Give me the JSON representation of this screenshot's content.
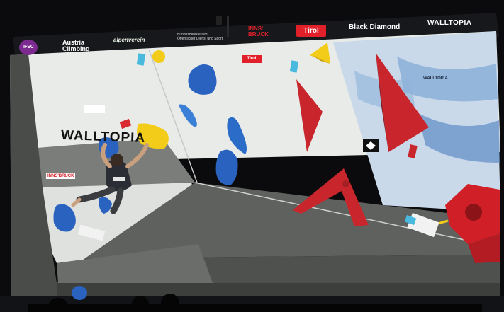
{
  "scene": {
    "description_colors": {
      "wall_light": "#e9ebe8",
      "wall_dark": "#5a5c5a",
      "hold_red": "#c8262c",
      "hold_blue": "#2a62c0",
      "hold_yellow": "#f2cc18",
      "banner_bg": "#17181c"
    }
  },
  "sponsors": {
    "ifsc": "IFSC",
    "austria_climbing_1": "Austria",
    "austria_climbing_2": "Climbing",
    "alpenverein": "alpenverein",
    "bmoe_1": "Bundesministerium",
    "bmoe_2": "Öffentlicher Dienst und Sport",
    "innsbruck_1": "INNS'",
    "innsbruck_2": "BRUCK",
    "tirol": "Tirol",
    "black_diamond": "Black Diamond",
    "walltopia": "WALLTOPIA"
  },
  "wall_labels": {
    "walltopia_big": "WALLTOPIA",
    "walltopia_small": "WALLTOPIA",
    "innsbruck_small": "INNS'BRUCK",
    "tirol_small": "Tirol"
  }
}
